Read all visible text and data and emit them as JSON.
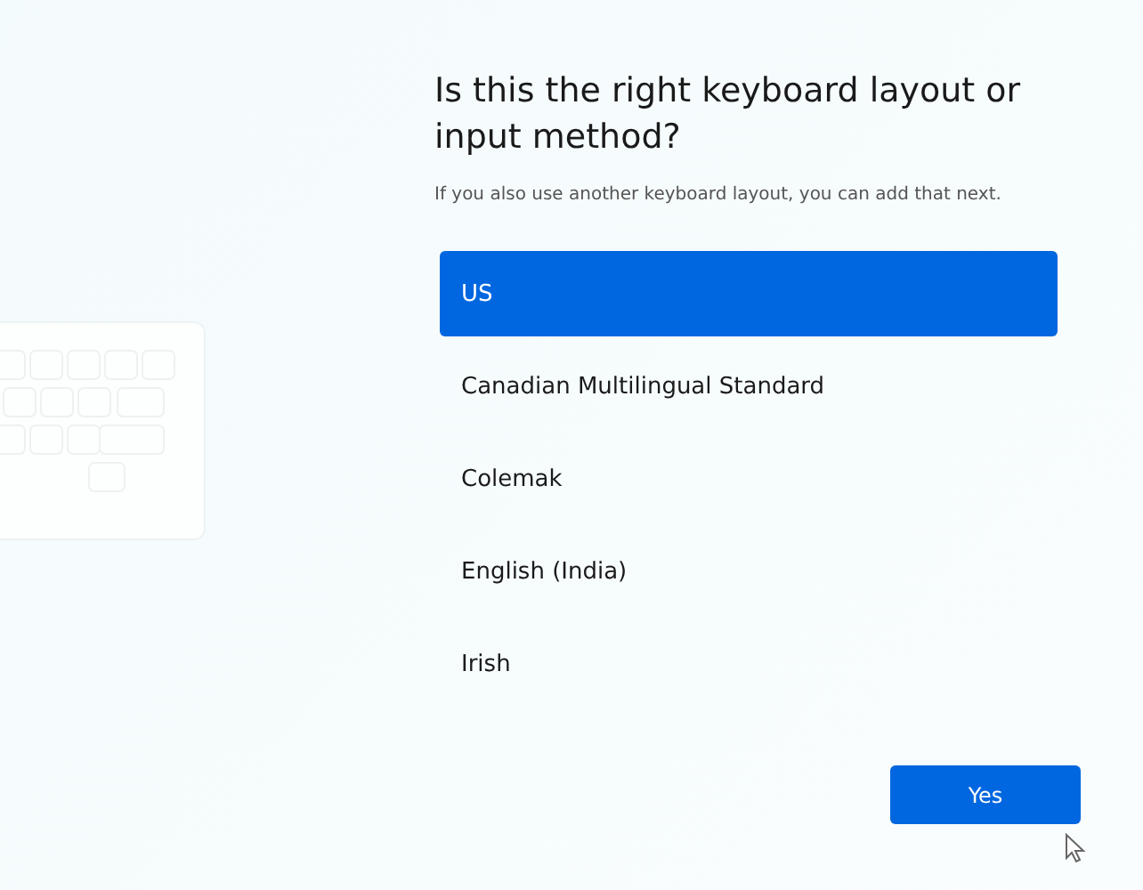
{
  "title": "Is this the right keyboard layout or input method?",
  "subtitle": "If you also use another keyboard layout, you can add that next.",
  "layouts": [
    {
      "label": "US",
      "selected": true
    },
    {
      "label": "Canadian Multilingual Standard",
      "selected": false
    },
    {
      "label": "Colemak",
      "selected": false
    },
    {
      "label": "English (India)",
      "selected": false
    },
    {
      "label": "Irish",
      "selected": false
    }
  ],
  "buttons": [
    {
      "label": "Yes"
    }
  ]
}
